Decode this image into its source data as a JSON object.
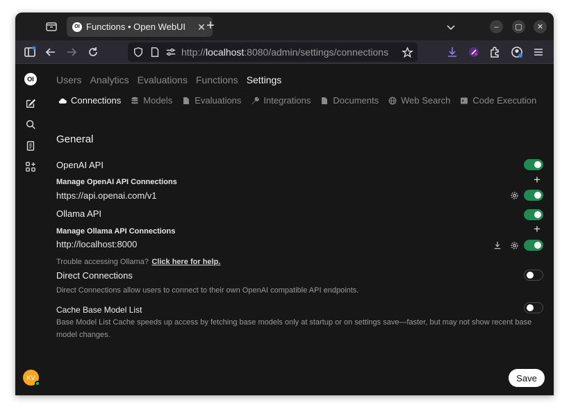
{
  "browser": {
    "tab_title": "Functions • Open WebUI",
    "url_prefix": "http://",
    "url_host": "localhost",
    "url_rest": ":8080/admin/settings/connections"
  },
  "app": {
    "logo_text": "OI",
    "avatar_initials": "KV"
  },
  "top_nav": {
    "users": "Users",
    "analytics": "Analytics",
    "evaluations": "Evaluations",
    "functions": "Functions",
    "settings": "Settings"
  },
  "sub_nav": {
    "connections": "Connections",
    "models": "Models",
    "evaluations": "Evaluations",
    "integrations": "Integrations",
    "documents": "Documents",
    "web_search": "Web Search",
    "code_execution": "Code Execution"
  },
  "general": {
    "heading": "General",
    "openai": {
      "label": "OpenAI API",
      "enabled": true,
      "manage_label": "Manage OpenAI API Connections",
      "connection_url": "https://api.openai.com/v1",
      "connection_enabled": true
    },
    "ollama": {
      "label": "Ollama API",
      "enabled": true,
      "manage_label": "Manage Ollama API Connections",
      "connection_url": "http://localhost:8000",
      "connection_enabled": true,
      "trouble_text": "Trouble accessing Ollama?",
      "help_link": "Click here for help."
    },
    "direct": {
      "label": "Direct Connections",
      "enabled": false,
      "description": "Direct Connections allow users to connect to their own OpenAI compatible API endpoints."
    },
    "cache": {
      "label": "Cache Base Model List",
      "enabled": false,
      "description": "Base Model List Cache speeds up access by fetching base models only at startup or on settings save—faster, but may not show recent base model changes."
    }
  },
  "save_label": "Save",
  "colors": {
    "toggle_on": "#1f8a52",
    "background": "#171717",
    "avatar": "#f5a623"
  }
}
